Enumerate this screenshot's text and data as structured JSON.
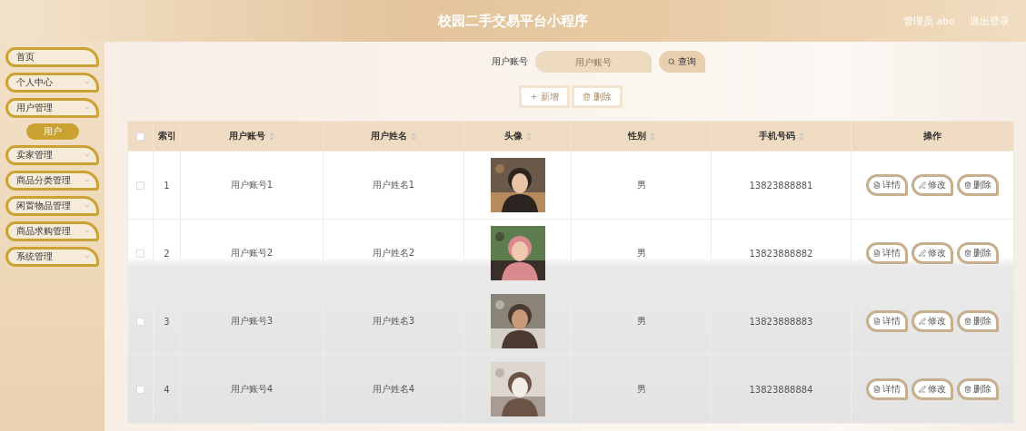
{
  "header": {
    "title": "校园二手交易平台小程序",
    "user": "管理员 abo",
    "logout": "退出登录"
  },
  "sidebar": {
    "items": [
      {
        "label": "首页",
        "expandable": false
      },
      {
        "label": "个人中心",
        "expandable": true
      },
      {
        "label": "用户管理",
        "expandable": true,
        "children": [
          {
            "label": "用户",
            "selected": true
          }
        ]
      },
      {
        "label": "卖家管理",
        "expandable": true
      },
      {
        "label": "商品分类管理",
        "expandable": true
      },
      {
        "label": "闲置物品管理",
        "expandable": true
      },
      {
        "label": "商品求购管理",
        "expandable": true
      },
      {
        "label": "系统管理",
        "expandable": true
      }
    ]
  },
  "search": {
    "label": "用户账号",
    "placeholder": "用户账号",
    "button": "查询"
  },
  "actions": {
    "add": "新增",
    "delete": "删除"
  },
  "table": {
    "all_checked": false,
    "columns": [
      {
        "label": "索引",
        "sortable": false
      },
      {
        "label": "用户账号",
        "sortable": true
      },
      {
        "label": "用户姓名",
        "sortable": true
      },
      {
        "label": "头像",
        "sortable": true
      },
      {
        "label": "性别",
        "sortable": true
      },
      {
        "label": "手机号码",
        "sortable": true
      },
      {
        "label": "操作",
        "sortable": false
      }
    ],
    "rows": [
      {
        "checked": false,
        "index": "1",
        "account": "用户账号1",
        "name": "用户姓名1",
        "avatar": {
          "kind": "picture"
        },
        "gender": "男",
        "phone": "13823888881",
        "buttons": [
          "详情",
          "修改",
          "删除"
        ]
      },
      {
        "checked": false,
        "index": "2",
        "account": "用户账号2",
        "name": "用户姓名2",
        "avatar": {
          "kind": "picture"
        },
        "gender": "男",
        "phone": "13823888882",
        "buttons": [
          "详情",
          "修改",
          "删除"
        ]
      },
      {
        "checked": false,
        "index": "3",
        "account": "用户账号3",
        "name": "用户姓名3",
        "avatar": {
          "kind": "picture"
        },
        "gender": "男",
        "phone": "13823888883",
        "buttons": [
          "详情",
          "修改",
          "删除"
        ]
      },
      {
        "checked": false,
        "index": "4",
        "account": "用户账号4",
        "name": "用户姓名4",
        "avatar": {
          "kind": "picture"
        },
        "gender": "男",
        "phone": "13823888884",
        "buttons": [
          "详情",
          "修改",
          "删除"
        ]
      }
    ]
  }
}
